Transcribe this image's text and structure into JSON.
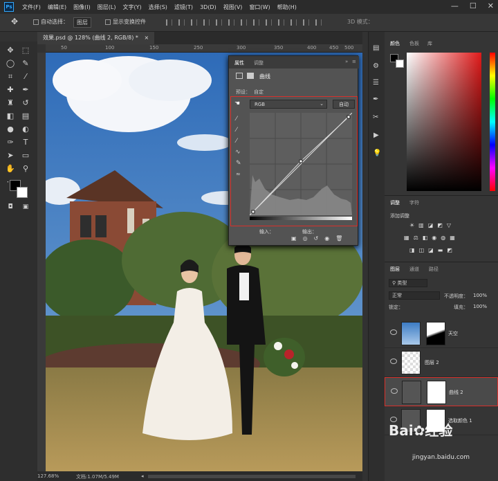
{
  "menubar": {
    "logo": "Ps",
    "items": [
      "文件(F)",
      "编辑(E)",
      "图像(I)",
      "图层(L)",
      "文字(Y)",
      "选择(S)",
      "滤镜(T)",
      "3D(D)",
      "视图(V)",
      "窗口(W)",
      "帮助(H)"
    ]
  },
  "options": {
    "auto_select": "自动选择：",
    "auto_select_value": "图层",
    "show_transform": "显示变换控件",
    "mode_3d": "3D 模式："
  },
  "document": {
    "tab_title": "效果.psd @ 128% (曲线 2, RGB/8) *",
    "close": "×",
    "ruler_marks": [
      "50",
      "100",
      "150",
      "200",
      "250",
      "300",
      "350",
      "400",
      "450",
      "500"
    ],
    "zoom": "127.68%",
    "doc_info": "文档:1.07M/5.49M"
  },
  "properties": {
    "tabs": [
      "属性",
      "调整"
    ],
    "title": "曲线",
    "preset_label": "预设：",
    "preset_value": "自定",
    "channel": "RGB",
    "auto_button": "自动",
    "input_label": "输入：",
    "output_label": "输出：",
    "collapse": "»",
    "menu": "≡"
  },
  "color_panel": {
    "tabs": [
      "颜色",
      "色板",
      "库"
    ]
  },
  "adjustments": {
    "tabs": [
      "调整",
      "字符"
    ],
    "add_label": "添加调整"
  },
  "layers_panel": {
    "tabs": [
      "图层",
      "通道",
      "路径"
    ],
    "filter_label": "类型",
    "blend_mode": "正常",
    "opacity_label": "不透明度：",
    "opacity_value": "100%",
    "lock_label": "锁定：",
    "fill_label": "填充：",
    "fill_value": "100%",
    "layers": [
      {
        "name": "天空"
      },
      {
        "name": "图层 2"
      },
      {
        "name": "曲线 2"
      },
      {
        "name": "选取颜色 1"
      }
    ]
  },
  "watermark": {
    "brand": "Bai",
    "brand2": "经验",
    "url": "jingyan.baidu.com"
  },
  "colors": {
    "accent_red": "#d9302b",
    "ps_blue": "#31a8ff"
  }
}
